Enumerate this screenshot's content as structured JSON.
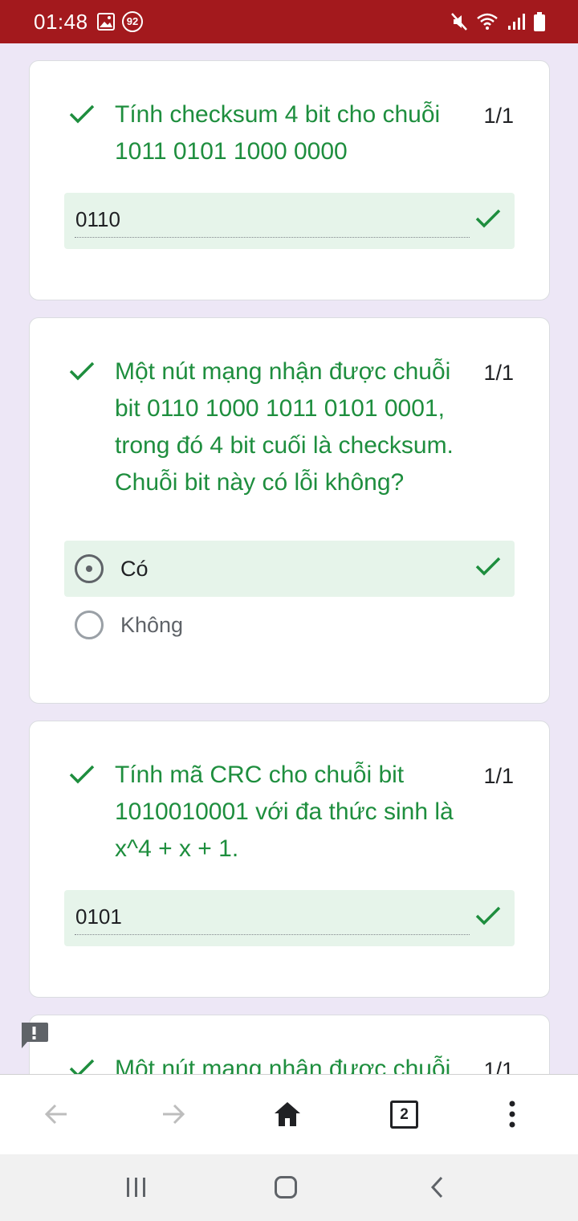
{
  "status_bar": {
    "time": "01:48",
    "notification_badge": "92",
    "icons": [
      "image-icon",
      "mute-icon",
      "wifi-icon",
      "signal-icon",
      "battery-icon"
    ]
  },
  "questions": [
    {
      "text": "Tính checksum 4 bit cho chuỗi 1011 0101 1000 0000",
      "score": "1/1",
      "answer": "0110"
    },
    {
      "text": "Một nút mạng nhận được chuỗi bit 0110 1000 1011 0101 0001, trong đó 4 bit cuối là checksum. Chuỗi bit này có lỗi không?",
      "score": "1/1",
      "options": [
        {
          "label": "Có",
          "selected": true,
          "correct": true
        },
        {
          "label": "Không",
          "selected": false
        }
      ]
    },
    {
      "text": "Tính mã CRC cho chuỗi bit 1010010001 với đa thức sinh là x^4 + x + 1.",
      "score": "1/1",
      "answer": "0101"
    },
    {
      "text": "Một nút mạng nhận được chuỗi",
      "score": "1/1"
    }
  ],
  "browser_toolbar": {
    "tab_count": "2",
    "icons": [
      "back-arrow-icon",
      "forward-arrow-icon",
      "home-icon",
      "tabs-icon",
      "more-menu-icon"
    ]
  },
  "colors": {
    "status_bar": "#a3191d",
    "background": "#ede7f6",
    "correct_green": "#1e8e3e",
    "correct_fill": "#e6f4ea"
  }
}
